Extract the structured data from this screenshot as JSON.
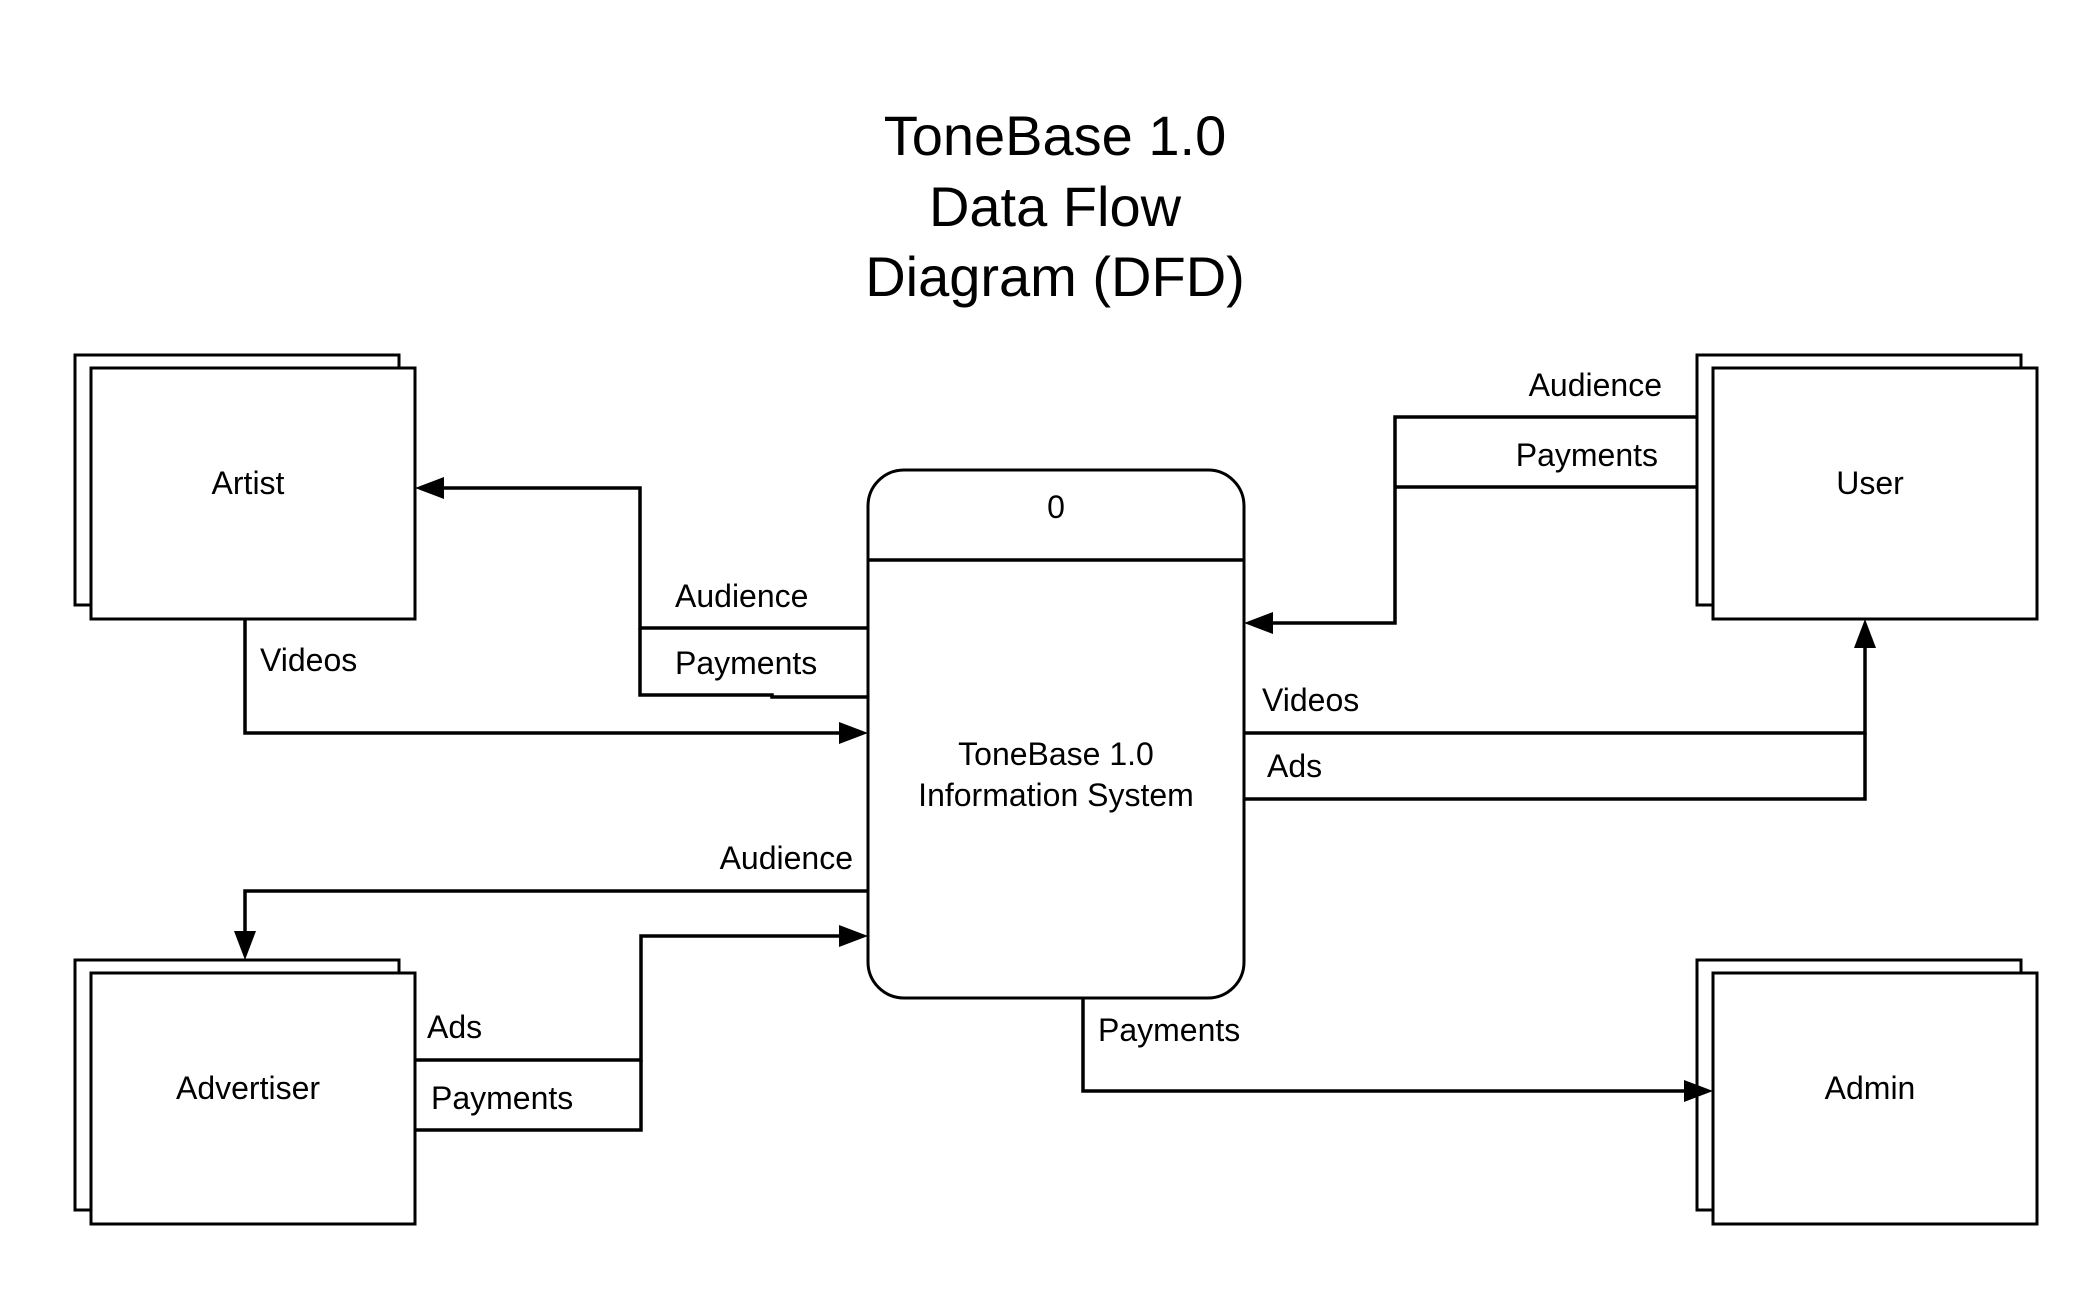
{
  "title": {
    "line1": "ToneBase 1.0",
    "line2": "Data Flow",
    "line3": "Diagram (DFD)"
  },
  "process": {
    "number": "0",
    "name_line1": "ToneBase 1.0",
    "name_line2": "Information System"
  },
  "entities": {
    "artist": "Artist",
    "user": "User",
    "advertiser": "Advertiser",
    "admin": "Admin"
  },
  "flows": {
    "system_to_artist_audience": "Audience",
    "system_to_artist_payments": "Payments",
    "artist_to_system_videos": "Videos",
    "user_to_system_audience": "Audience",
    "user_to_system_payments": "Payments",
    "system_to_user_videos": "Videos",
    "system_to_user_ads": "Ads",
    "system_to_advertiser_audience": "Audience",
    "advertiser_to_system_ads": "Ads",
    "advertiser_to_system_payments": "Payments",
    "system_to_admin_payments": "Payments"
  }
}
